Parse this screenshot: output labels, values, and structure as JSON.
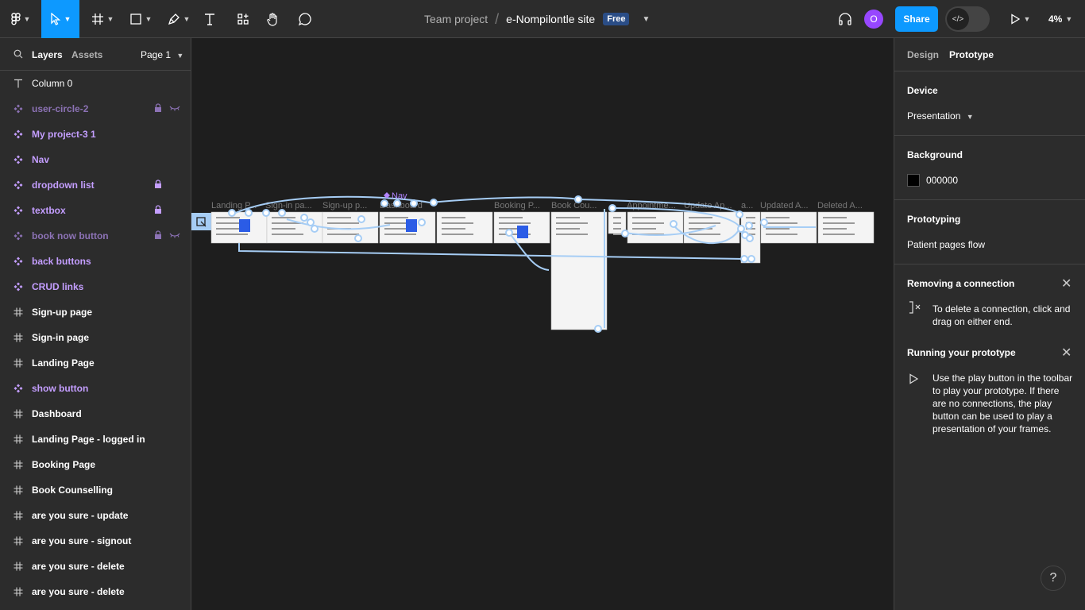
{
  "toolbar": {
    "team": "Team project",
    "file_name": "e-Nompilontle site",
    "plan_badge": "Free",
    "avatar_initial": "O",
    "share_label": "Share",
    "zoom": "4%"
  },
  "left_panel": {
    "tab_layers": "Layers",
    "tab_assets": "Assets",
    "page_selector": "Page 1",
    "layers": [
      {
        "label": "Column 0",
        "kind": "text"
      },
      {
        "label": "user-circle-2",
        "kind": "component-dim"
      },
      {
        "label": "My project-3 1",
        "kind": "component"
      },
      {
        "label": "Nav",
        "kind": "component"
      },
      {
        "label": "dropdown list",
        "kind": "component"
      },
      {
        "label": "textbox",
        "kind": "component"
      },
      {
        "label": "book now button",
        "kind": "component-dim"
      },
      {
        "label": "back buttons",
        "kind": "component"
      },
      {
        "label": "CRUD links",
        "kind": "component"
      },
      {
        "label": "Sign-up page",
        "kind": "frame"
      },
      {
        "label": "Sign-in page",
        "kind": "frame"
      },
      {
        "label": "Landing Page",
        "kind": "frame"
      },
      {
        "label": "show button",
        "kind": "component"
      },
      {
        "label": "Dashboard",
        "kind": "frame"
      },
      {
        "label": "Landing Page - logged in",
        "kind": "frame"
      },
      {
        "label": "Booking Page",
        "kind": "frame"
      },
      {
        "label": "Book Counselling",
        "kind": "frame"
      },
      {
        "label": "are you sure - update",
        "kind": "frame"
      },
      {
        "label": "are you sure - signout",
        "kind": "frame"
      },
      {
        "label": "are you sure - delete",
        "kind": "frame"
      },
      {
        "label": "are you sure - delete",
        "kind": "frame"
      }
    ]
  },
  "canvas": {
    "nav_label": "Nav",
    "frame_labels": [
      "Landing P...",
      "Sign-in pa...",
      "Sign-up p...",
      "Dashboard",
      "Booking P...",
      "Book Cou...",
      "Appointme...",
      "Update Ap...",
      "a...",
      "Updated A...",
      "Deleted A..."
    ]
  },
  "right_panel": {
    "tab_design": "Design",
    "tab_prototype": "Prototype",
    "device_title": "Device",
    "device_value": "Presentation",
    "background_title": "Background",
    "background_hex": "000000",
    "prototyping_title": "Prototyping",
    "flow_name": "Patient pages flow",
    "removing_title": "Removing a connection",
    "removing_text": "To delete a connection, click and drag on either end.",
    "running_title": "Running your prototype",
    "running_text": "Use the play button in the toolbar to play your prototype. If there are no connections, the play button can be used to play a presentation of your frames."
  },
  "colors": {
    "accent": "#0d99ff",
    "component": "#c49eff",
    "connector": "#a6cdf5"
  }
}
